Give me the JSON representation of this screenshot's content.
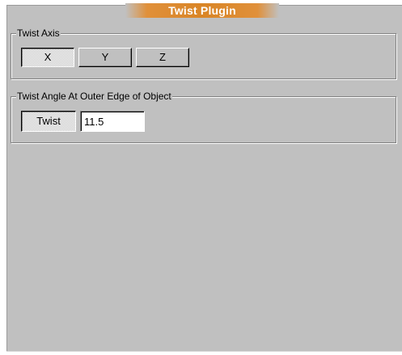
{
  "title": "Twist Plugin",
  "colors": {
    "panel_bg": "#c0c0c0",
    "title_accent": "#d98526",
    "title_text": "#ffffff"
  },
  "twist_axis": {
    "legend": "Twist Axis",
    "buttons": [
      {
        "label": "X",
        "selected": true
      },
      {
        "label": "Y",
        "selected": false
      },
      {
        "label": "Z",
        "selected": false
      }
    ]
  },
  "twist_angle": {
    "legend": "Twist Angle At Outer Edge of Object",
    "button_label": "Twist",
    "value": "11.5"
  }
}
